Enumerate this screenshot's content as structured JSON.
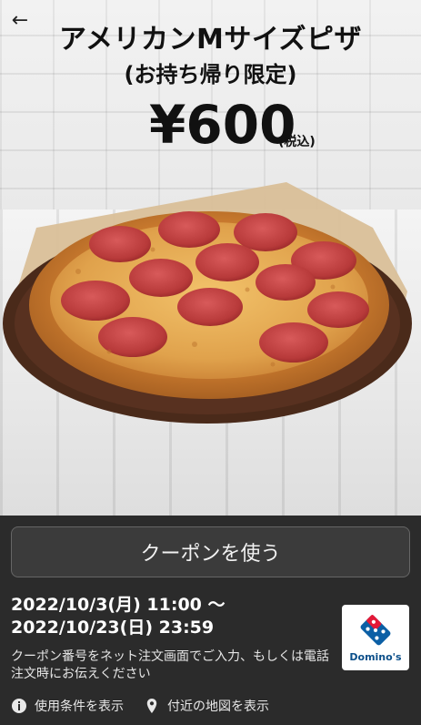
{
  "header": {
    "back_icon": "arrow-left-icon",
    "title": "アメリカンMサイズピザ",
    "subtitle": "(お持ち帰り限定)"
  },
  "offer": {
    "price": "¥600",
    "tax_note": "(税込)"
  },
  "actions": {
    "use_coupon": "クーポンを使う"
  },
  "validity": {
    "start": "2022/10/3(月) 11:00 〜",
    "end": "2022/10/23(日) 23:59"
  },
  "instructions": "クーポン番号をネット注文画面でご入力、もしくは電話注文時にお伝えください",
  "brand": {
    "logo_text": "Domino's",
    "colors": {
      "blue": "#0b5fa5",
      "red": "#e31837"
    }
  },
  "links": {
    "terms": "使用条件を表示",
    "map": "付近の地図を表示",
    "terms_icon": "info-icon",
    "map_icon": "location-pin-icon"
  }
}
